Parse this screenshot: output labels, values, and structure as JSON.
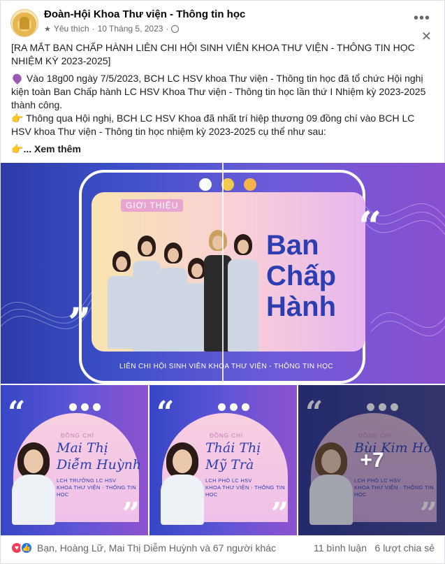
{
  "post": {
    "page_name": "Đoàn-Hội Khoa Thư viện - Thông tin học",
    "meta_label": "Yêu thích",
    "meta_sep": "·",
    "date": "10 Tháng 5, 2023",
    "more_icon": "more-horizontal-icon",
    "close_icon": "close-icon",
    "title_line": "[RA MẮT BAN CHẤP HÀNH LIÊN CHI HỘI SINH VIÊN KHOA THƯ VIỆN - THÔNG TIN HỌC NHIỆM KỲ 2023-2025]",
    "para1": "Vào 18g00 ngày 7/5/2023, BCH LC HSV khoa Thư viện - Thông tin học đã tổ chức Hội nghị kiện toàn Ban Chấp hành LC HSV Khoa Thư viện - Thông tin học lần thứ I Nhiệm kỳ 2023-2025 thành công.",
    "para2": "Thông qua Hội nghị, BCH LC HSV Khoa đã nhất trí hiệp thương 09 đồng chí vào BCH LC HSV khoa Thư viện - Thông tin học nhiệm kỳ 2023-2025 cụ thể như sau:",
    "see_more": "... Xem thêm"
  },
  "main_image": {
    "badge": "GIỚI THIỆU",
    "title_line1": "Ban",
    "title_line2": "Chấp",
    "title_line3": "Hành",
    "footer": "LIÊN CHI HỘI SINH VIÊN KHOA THƯ VIỆN - THÔNG TIN HỌC"
  },
  "thumbnails": [
    {
      "label": "ĐỒNG CHÍ",
      "name1": "Mai Thị",
      "name2": "Diễm Huỳnh",
      "role1": "LCH TRƯỞNG LC HSV",
      "role2": "KHOA THƯ VIỆN - THÔNG TIN HỌC"
    },
    {
      "label": "ĐỒNG CHÍ",
      "name1": "Thái Thị",
      "name2": "Mỹ Trà",
      "role1": "LCH PHÓ LC HSV",
      "role2": "KHOA THƯ VIỆN - THÔNG TIN HỌC"
    },
    {
      "label": "ĐỒNG CHÍ",
      "name1": "Bùi Kim Hồ",
      "name2": "",
      "role1": "LCH PHÓ LC HSV",
      "role2": "KHOA THƯ VIỆN - THÔNG TIN HỌC",
      "more_count": "+7"
    }
  ],
  "footer": {
    "reactions_text": "Bạn, Hoàng Lữ, Mai Thị Diễm Huỳnh và 67 người khác",
    "comments": "11 bình luận",
    "shares": "6 lượt chia sẻ"
  }
}
